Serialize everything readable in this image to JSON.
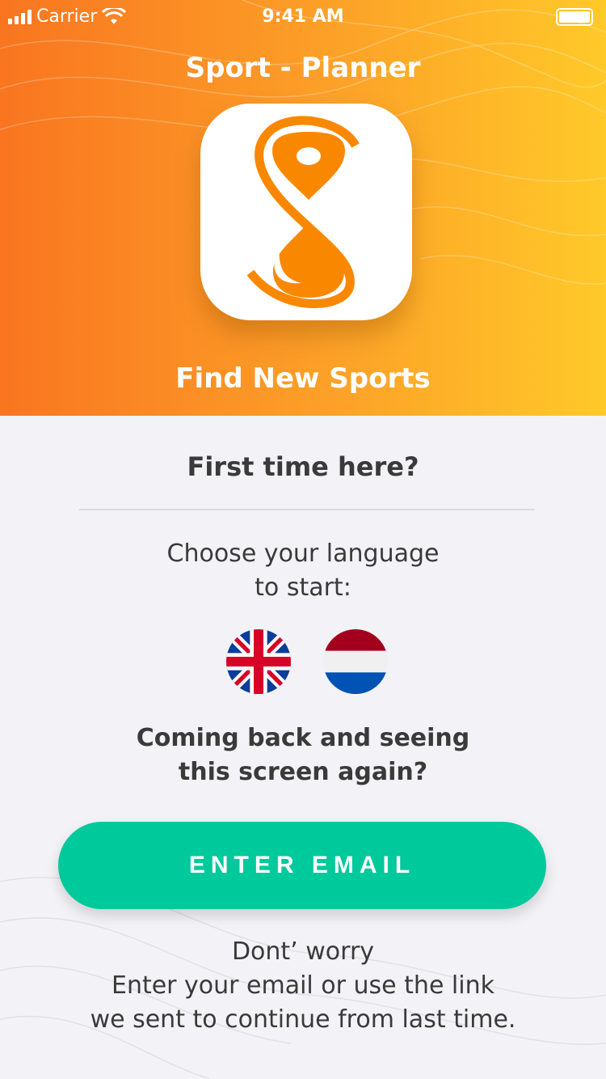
{
  "status_bar": {
    "carrier": "Carrier",
    "time": "9:41 AM"
  },
  "header": {
    "app_title": "Sport - Planner",
    "tagline": "Find New Sports"
  },
  "main": {
    "heading": "First time here?",
    "choose_line1": "Choose your language",
    "choose_line2": "to start:",
    "languages": [
      {
        "name": "English",
        "icon": "uk-flag-icon"
      },
      {
        "name": "Dutch",
        "icon": "netherlands-flag-icon"
      }
    ],
    "returning_line1": "Coming back and seeing",
    "returning_line2": "this screen again?",
    "enter_email_label": "ENTER EMAIL",
    "info_line1": "Dont’ worry",
    "info_line2": "Enter your email or use the link",
    "info_line3": "we sent to continue from last time."
  },
  "colors": {
    "accent": "#00c99c",
    "brand_orange": "#f98800",
    "gradient_start": "#f97520",
    "gradient_end": "#ffc929"
  }
}
